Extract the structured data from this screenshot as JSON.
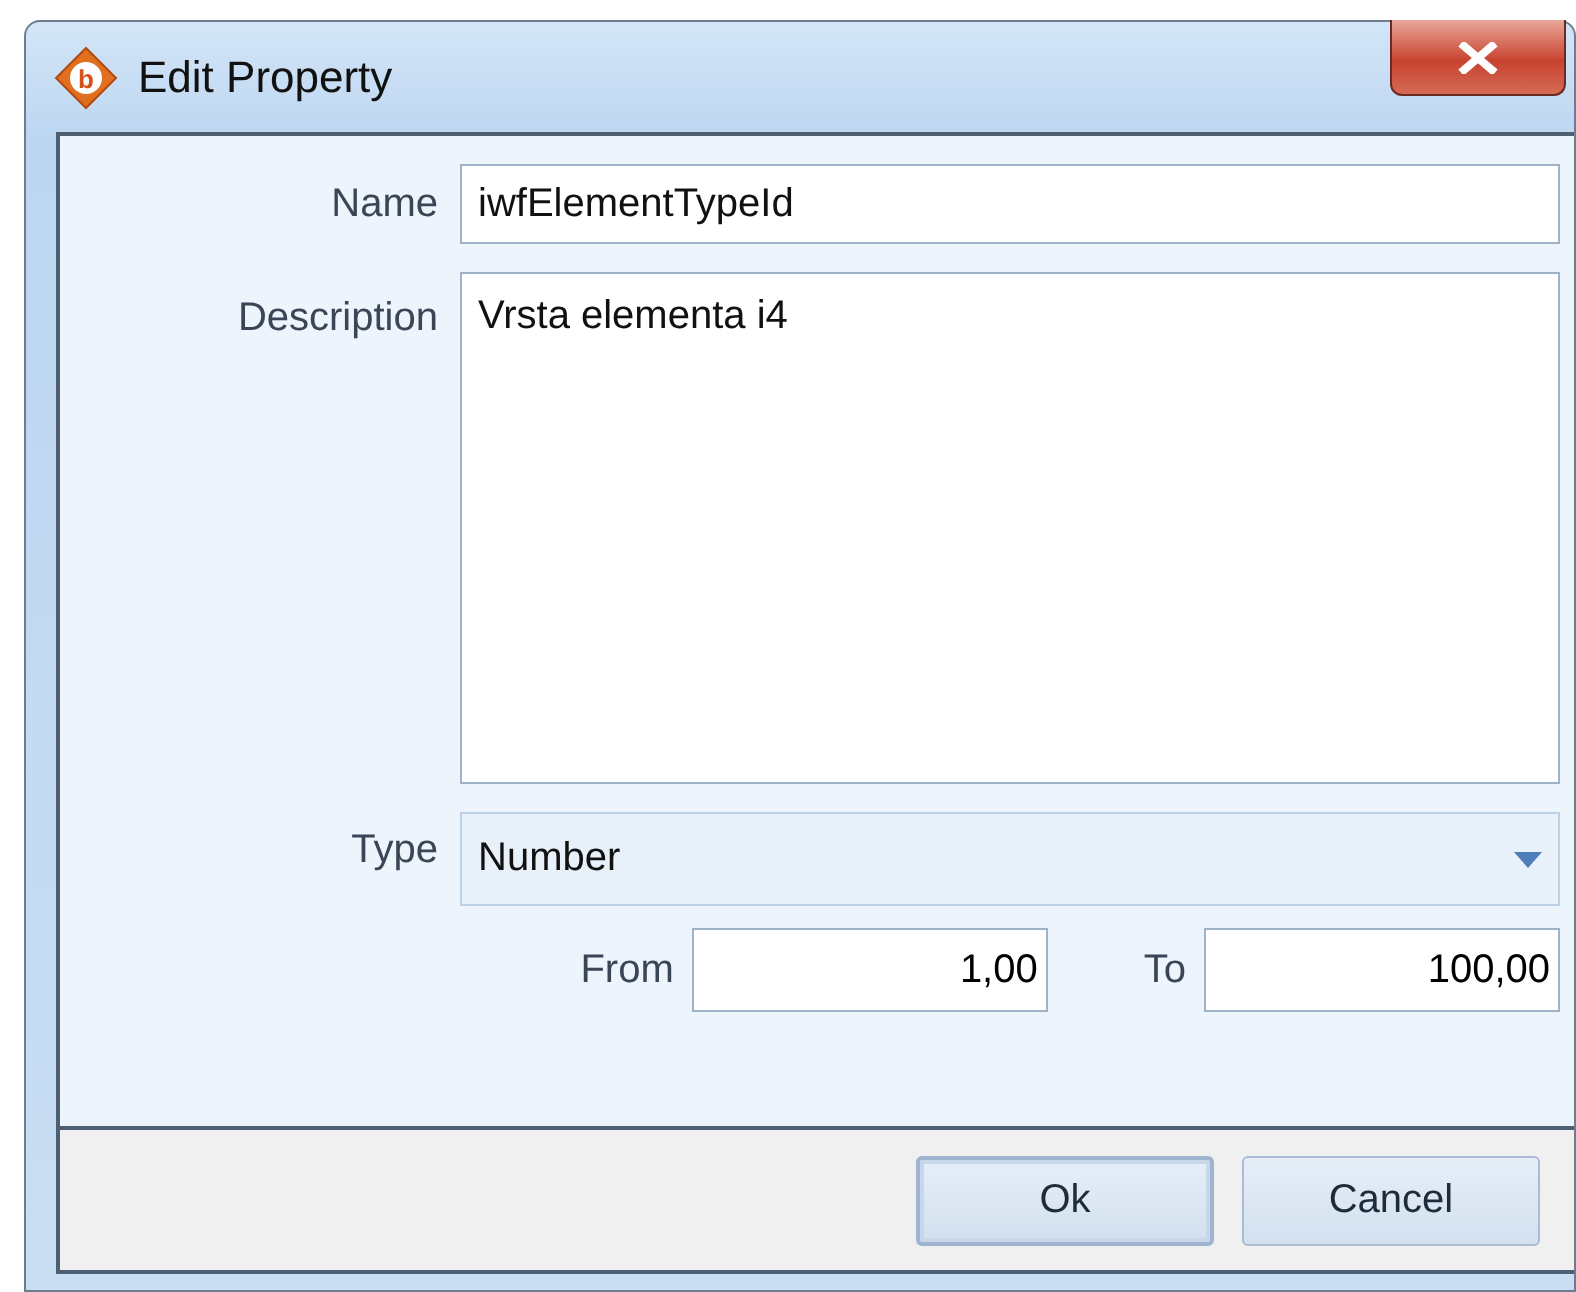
{
  "window": {
    "title": "Edit Property",
    "app_icon_letter": "b"
  },
  "fields": [
    {
      "label": "Name",
      "kind": "text",
      "value": "iwfElementTypeId"
    },
    {
      "label": "Description",
      "kind": "multiline",
      "value": "Vrsta elementa i4"
    },
    {
      "label": "Type",
      "kind": "dropdown",
      "value": "Number"
    }
  ],
  "range": [
    {
      "label": "From",
      "value": "1,00"
    },
    {
      "label": "To",
      "value": "100,00"
    }
  ],
  "buttons": [
    {
      "label": "Ok",
      "default": true
    },
    {
      "label": "Cancel",
      "default": false
    }
  ]
}
